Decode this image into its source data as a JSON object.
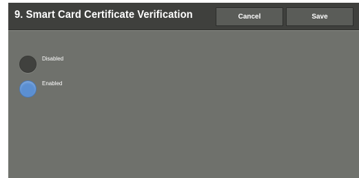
{
  "header": {
    "title": "9. Smart Card Certificate Verification",
    "cancel_label": "Cancel",
    "save_label": "Save"
  },
  "options": {
    "disabled_label": "Disabled",
    "enabled_label": "Enabled",
    "selected": "Enabled"
  },
  "colors": {
    "background": "#6f716c",
    "header": "#3f403d",
    "selected_radio": "#5b8fd2",
    "unselected_radio": "#40413e"
  }
}
